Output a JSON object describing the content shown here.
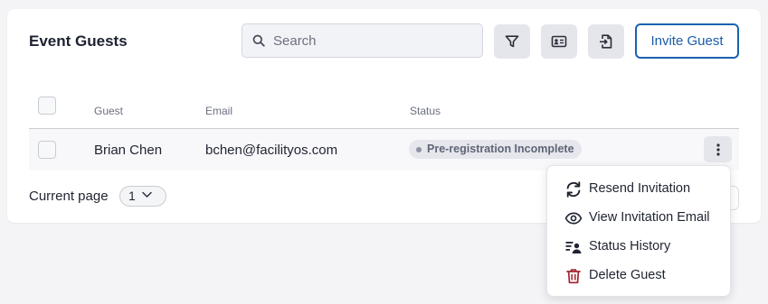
{
  "header": {
    "title": "Event Guests"
  },
  "search": {
    "placeholder": "Search",
    "value": ""
  },
  "toolbar": {
    "filter_icon": "filter-icon",
    "card_icon": "id-card-icon",
    "export_icon": "file-export-icon",
    "invite_label": "Invite Guest"
  },
  "table": {
    "columns": {
      "guest": "Guest",
      "email": "Email",
      "status": "Status"
    },
    "rows": [
      {
        "guest": "Brian Chen",
        "email": "bchen@facilityos.com",
        "status": "Pre-registration Incomplete"
      }
    ]
  },
  "pagination": {
    "label": "Current page",
    "value": "1"
  },
  "row_menu": {
    "items": [
      {
        "label": "Resend Invitation",
        "icon": "refresh-icon"
      },
      {
        "label": "View Invitation Email",
        "icon": "eye-icon"
      },
      {
        "label": "Status History",
        "icon": "status-history-icon"
      },
      {
        "label": "Delete Guest",
        "icon": "trash-icon"
      }
    ]
  },
  "colors": {
    "accent": "#1a62b0",
    "danger": "#a3242f",
    "badge_bg": "#e5e7ec",
    "button_bg": "#e4e6eb"
  }
}
